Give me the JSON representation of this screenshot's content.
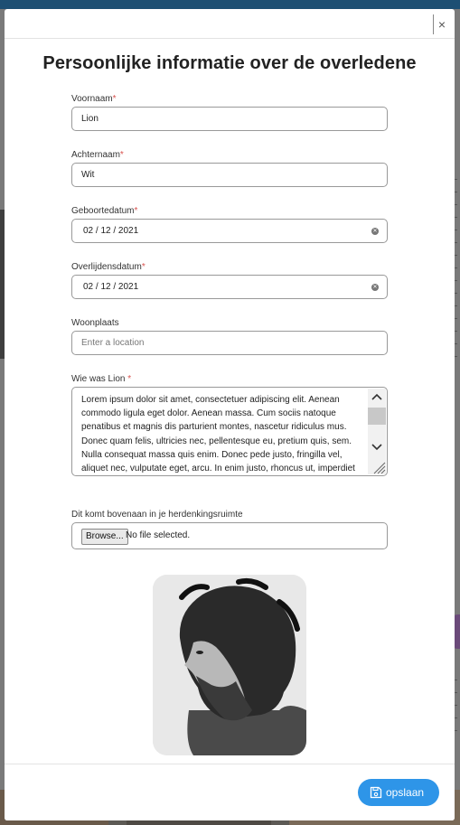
{
  "modal": {
    "title": "Persoonlijke informatie over de overledene",
    "close_label": "×"
  },
  "fields": {
    "first_name": {
      "label": "Voornaam",
      "required_mark": "*",
      "value": "Lion"
    },
    "last_name": {
      "label": "Achternaam",
      "required_mark": "*",
      "value": "Wit"
    },
    "birth_date": {
      "label": "Geboortedatum",
      "required_mark": "*",
      "value": "02 / 12 / 2021"
    },
    "death_date": {
      "label": "Overlijdensdatum",
      "required_mark": "*",
      "value": "02 / 12 / 2021"
    },
    "residence": {
      "label": "Woonplaats",
      "placeholder": "Enter a location"
    },
    "about": {
      "label": "Wie was Lion",
      "required_mark": "*",
      "value": "Lorem ipsum dolor sit amet, consectetuer adipiscing elit. Aenean commodo ligula eget dolor. Aenean massa. Cum sociis natoque penatibus et magnis dis parturient montes, nascetur ridiculus mus. Donec quam felis, ultricies nec, pellentesque eu, pretium quis, sem. Nulla consequat massa quis enim. Donec pede justo, fringilla vel, aliquet nec, vulputate eget, arcu. In enim justo, rhoncus ut, imperdiet"
    },
    "cover_image": {
      "label": "Dit komt bovenaan in je herdenkingsruimte",
      "browse_label": "Browse...",
      "status": "No file selected."
    }
  },
  "footer": {
    "save_label": "opslaan"
  },
  "icons": {
    "close": "close-icon",
    "clear": "clear-date-icon",
    "save": "floppy-disk-icon"
  },
  "colors": {
    "accent": "#2e95e8",
    "required": "#d9534f"
  }
}
